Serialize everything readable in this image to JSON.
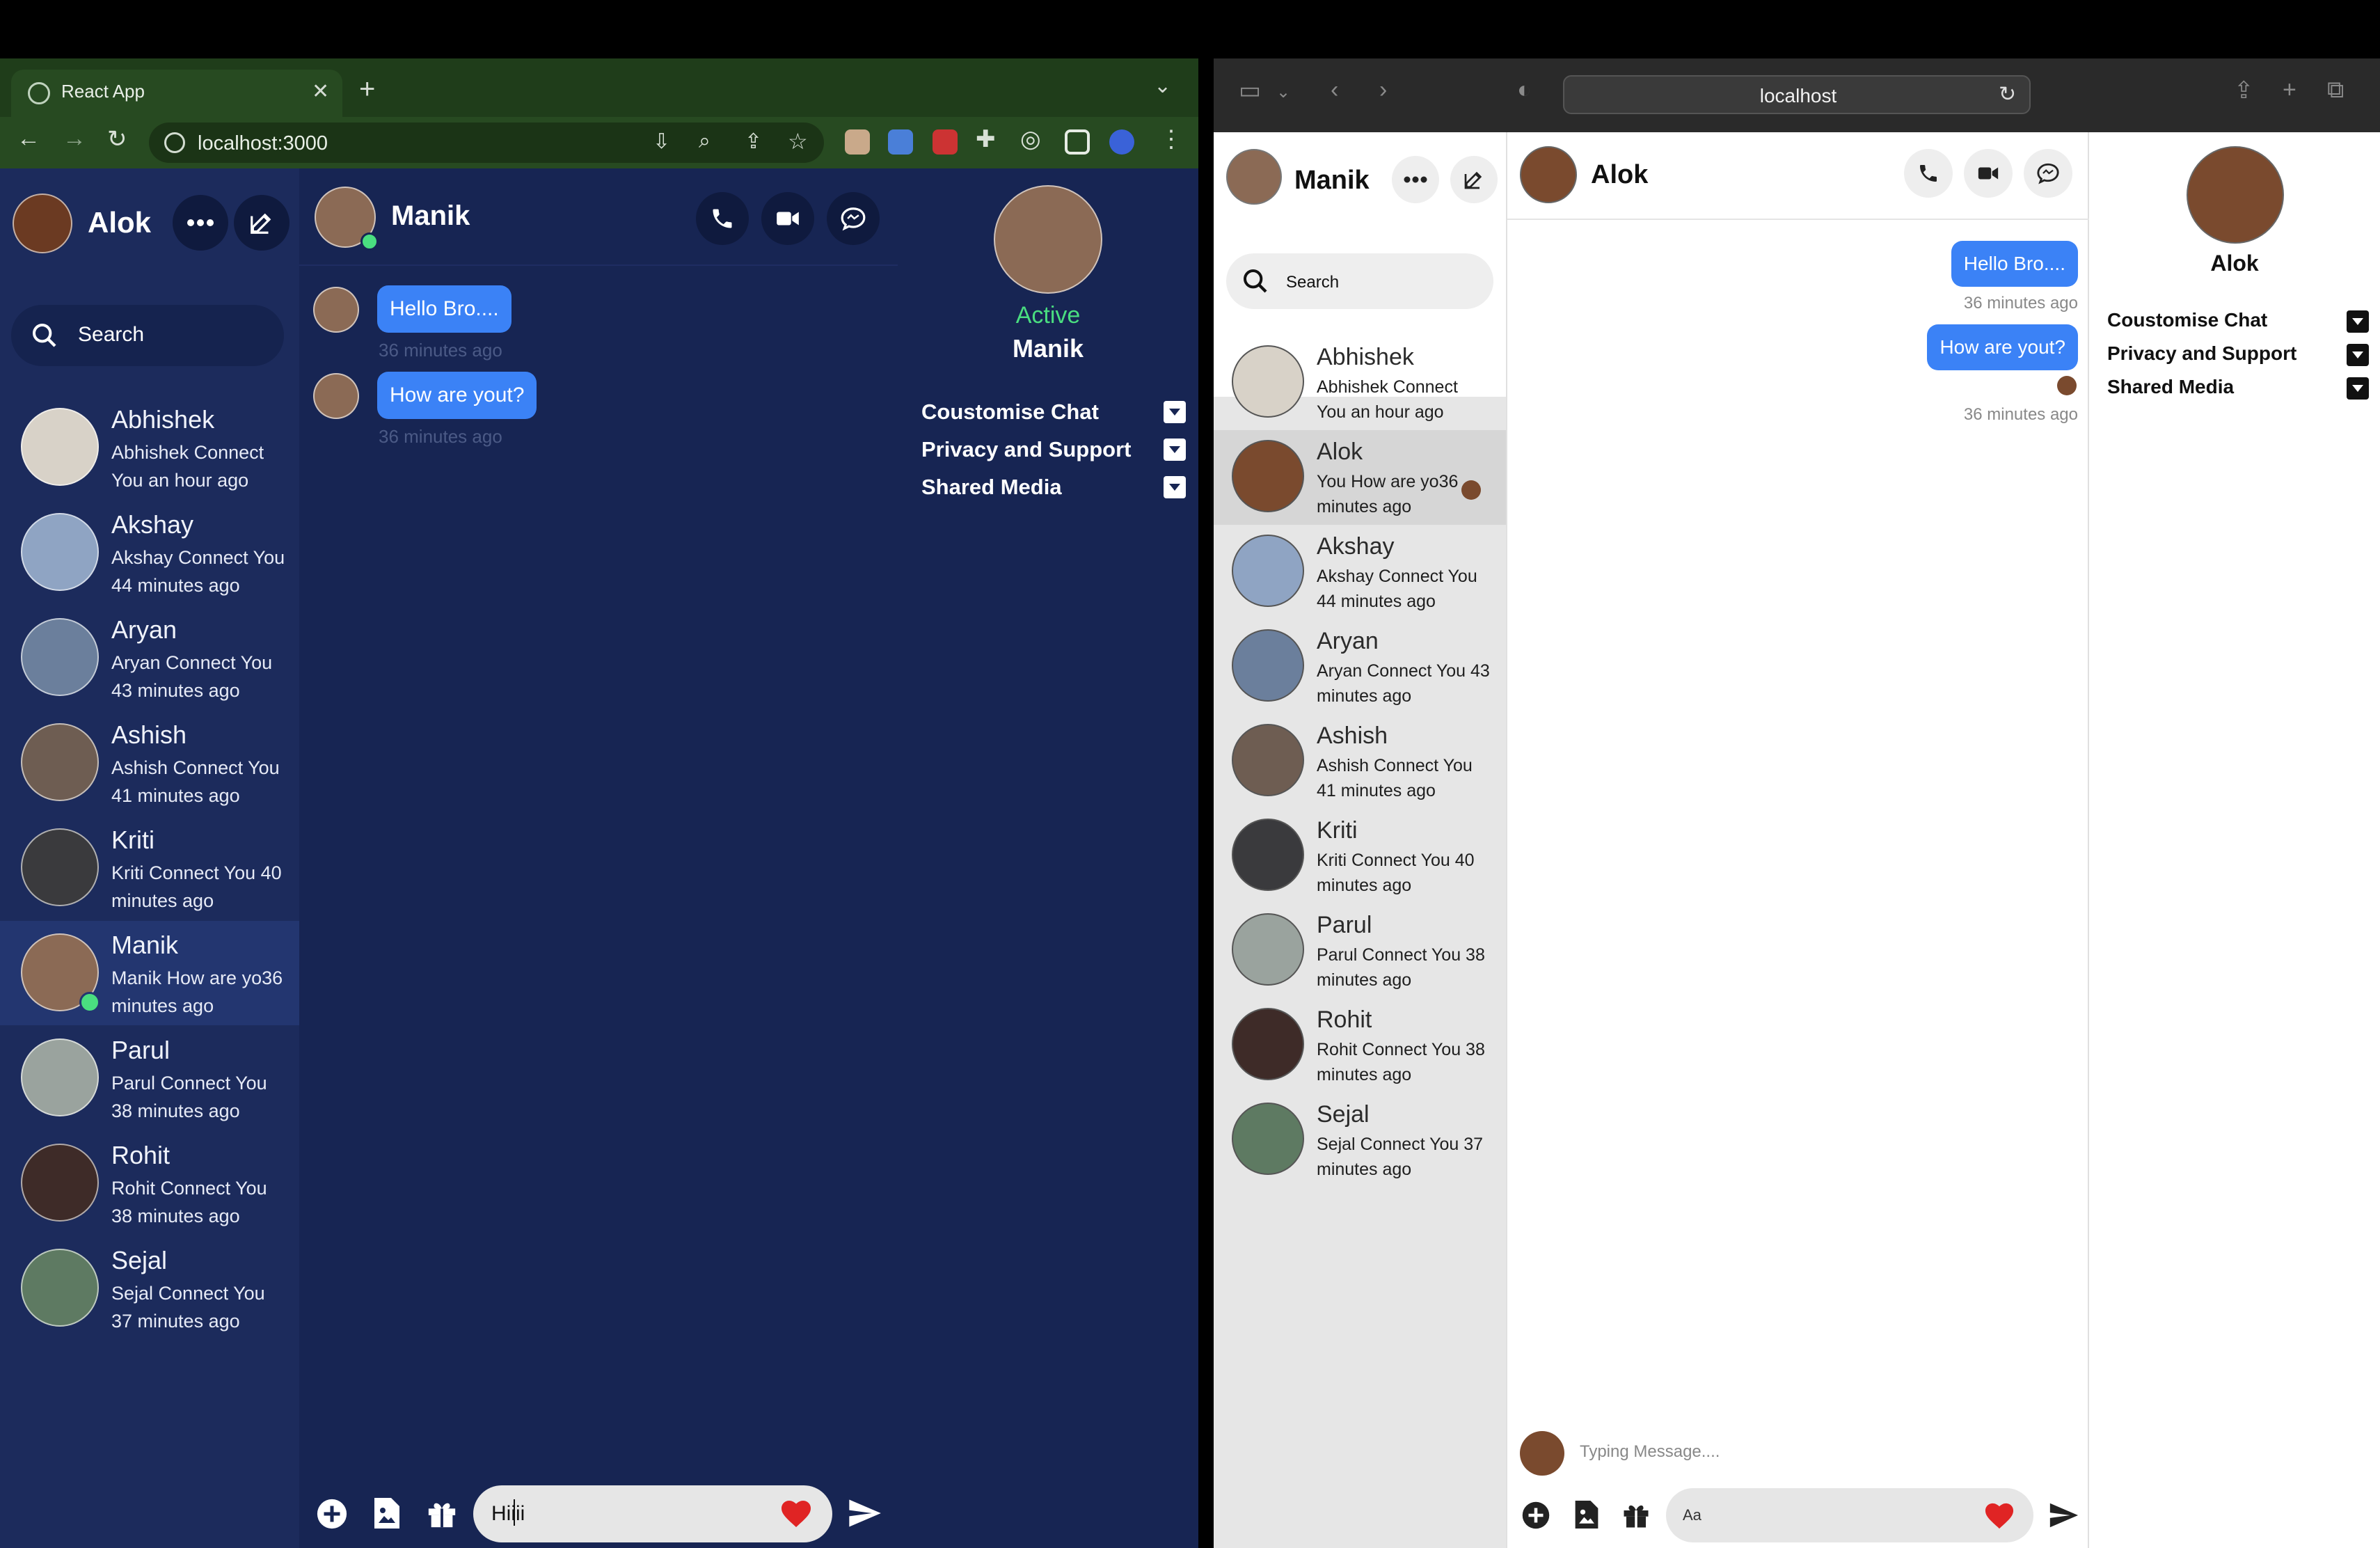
{
  "left_window": {
    "tab_title": "React App",
    "url": "localhost:3000",
    "app": {
      "user_name": "Alok",
      "search_placeholder": "Search",
      "contacts": [
        {
          "name": "Abhishek",
          "sub": "Abhishek Connect You an hour ago",
          "online": false,
          "selected": false,
          "av_color": "#d8d2c8"
        },
        {
          "name": "Akshay",
          "sub": "Akshay Connect You 44 minutes ago",
          "online": false,
          "selected": false,
          "av_color": "#8fa4c3"
        },
        {
          "name": "Aryan",
          "sub": "Aryan Connect You 43 minutes ago",
          "online": false,
          "selected": false,
          "av_color": "#6b7f9c"
        },
        {
          "name": "Ashish",
          "sub": "Ashish Connect You 41 minutes ago",
          "online": false,
          "selected": false,
          "av_color": "#6e5d52"
        },
        {
          "name": "Kriti",
          "sub": "Kriti Connect You 40 minutes ago",
          "online": false,
          "selected": false,
          "av_color": "#3a3a3d"
        },
        {
          "name": "Manik",
          "sub": "Manik How are yo36 minutes ago",
          "online": true,
          "selected": true,
          "av_color": "#8b6a55"
        },
        {
          "name": "Parul",
          "sub": "Parul Connect You 38 minutes ago",
          "online": false,
          "selected": false,
          "av_color": "#9aa39e"
        },
        {
          "name": "Rohit",
          "sub": "Rohit Connect You 38 minutes ago",
          "online": false,
          "selected": false,
          "av_color": "#3e2b28"
        },
        {
          "name": "Sejal",
          "sub": "Sejal Connect You 37 minutes ago",
          "online": false,
          "selected": false,
          "av_color": "#5e7a62"
        }
      ],
      "chat": {
        "contact_name": "Manik",
        "messages": [
          {
            "text": "Hello Bro....",
            "time": "36 minutes ago"
          },
          {
            "text": "How are yout?",
            "time": "36 minutes ago"
          }
        ],
        "input_value": "Hiiii"
      },
      "info": {
        "status": "Active",
        "name": "Manik",
        "options": [
          "Coustomise Chat",
          "Privacy and Support",
          "Shared Media"
        ]
      }
    }
  },
  "right_window": {
    "url": "localhost",
    "app": {
      "user_name": "Manik",
      "search_placeholder": "Search",
      "contacts": [
        {
          "name": "Abhishek",
          "sub": "Abhishek Connect You an hour ago",
          "selected": false,
          "seen": false,
          "av_color": "#d8d2c8"
        },
        {
          "name": "Alok",
          "sub": "You How are yo36 minutes ago",
          "selected": true,
          "seen": true,
          "av_color": "#7a4a2e"
        },
        {
          "name": "Akshay",
          "sub": "Akshay Connect You 44 minutes ago",
          "selected": false,
          "seen": false,
          "av_color": "#8fa4c3"
        },
        {
          "name": "Aryan",
          "sub": "Aryan Connect You 43 minutes ago",
          "selected": false,
          "seen": false,
          "av_color": "#6b7f9c"
        },
        {
          "name": "Ashish",
          "sub": "Ashish Connect You 41 minutes ago",
          "selected": false,
          "seen": false,
          "av_color": "#6e5d52"
        },
        {
          "name": "Kriti",
          "sub": "Kriti Connect You 40 minutes ago",
          "selected": false,
          "seen": false,
          "av_color": "#3a3a3d"
        },
        {
          "name": "Parul",
          "sub": "Parul Connect You 38 minutes ago",
          "selected": false,
          "seen": false,
          "av_color": "#9aa39e"
        },
        {
          "name": "Rohit",
          "sub": "Rohit Connect You 38 minutes ago",
          "selected": false,
          "seen": false,
          "av_color": "#3e2b28"
        },
        {
          "name": "Sejal",
          "sub": "Sejal Connect You 37 minutes ago",
          "selected": false,
          "seen": false,
          "av_color": "#5e7a62"
        }
      ],
      "chat": {
        "contact_name": "Alok",
        "messages": [
          {
            "text": "Hello Bro....",
            "time": "36 minutes ago"
          },
          {
            "text": "How are yout?",
            "time": "36 minutes ago"
          }
        ],
        "typing_text": "Typing Message....",
        "input_placeholder": "Aa"
      },
      "info": {
        "name": "Alok",
        "options": [
          "Coustomise Chat",
          "Privacy and Support",
          "Shared Media"
        ]
      }
    }
  },
  "colors": {
    "accent_blue": "#3b82f6",
    "active_green": "#4ade80",
    "dark_bg": "#172553",
    "heart": "#e02424"
  },
  "icons": [
    "search-icon",
    "more-icon",
    "edit-icon",
    "phone-icon",
    "video-icon",
    "message-icon",
    "plus-circle-icon",
    "image-file-icon",
    "gift-icon",
    "heart-icon",
    "send-icon",
    "dropdown-icon"
  ]
}
